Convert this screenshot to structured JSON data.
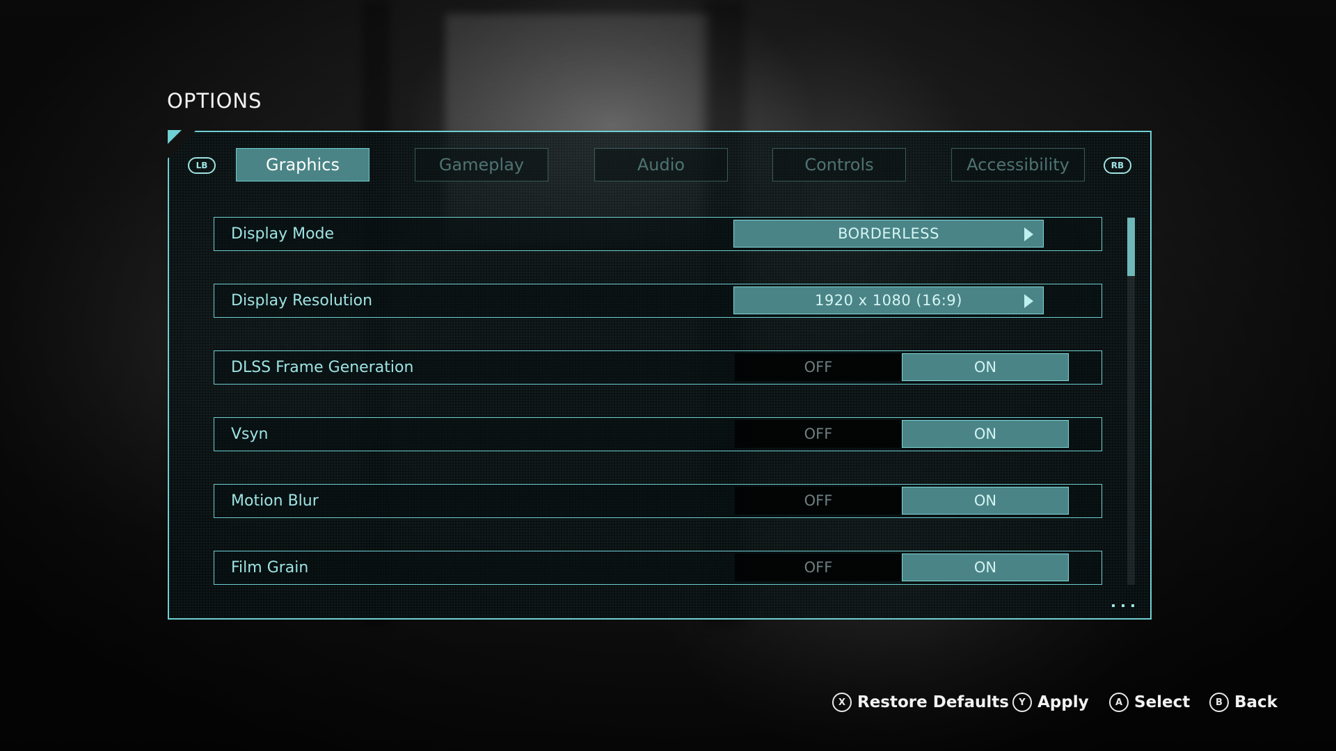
{
  "page": {
    "title": "OPTIONS"
  },
  "tabs": {
    "left_bumper": "LB",
    "right_bumper": "RB",
    "items": [
      {
        "label": "Graphics",
        "active": true
      },
      {
        "label": "Gameplay",
        "active": false
      },
      {
        "label": "Audio",
        "active": false
      },
      {
        "label": "Controls",
        "active": false
      },
      {
        "label": "Accessibility",
        "active": false
      }
    ]
  },
  "settings": [
    {
      "label": "Display Mode",
      "type": "selector",
      "value": "BORDERLESS"
    },
    {
      "label": "Display Resolution",
      "type": "selector",
      "value": "1920 x 1080 (16:9)"
    },
    {
      "label": "DLSS Frame Generation",
      "type": "toggle",
      "off_label": "OFF",
      "on_label": "ON",
      "value": "ON"
    },
    {
      "label": "Vsyn",
      "type": "toggle",
      "off_label": "OFF",
      "on_label": "ON",
      "value": "ON"
    },
    {
      "label": "Motion Blur",
      "type": "toggle",
      "off_label": "OFF",
      "on_label": "ON",
      "value": "ON"
    },
    {
      "label": "Film Grain",
      "type": "toggle",
      "off_label": "OFF",
      "on_label": "ON",
      "value": "ON"
    }
  ],
  "scroll": {
    "position": 0.0,
    "visible_fraction": 0.16
  },
  "footer": {
    "restore": {
      "glyph": "X",
      "label": "Restore Defaults"
    },
    "apply": {
      "glyph": "Y",
      "label": "Apply"
    },
    "select": {
      "glyph": "A",
      "label": "Select"
    },
    "back": {
      "glyph": "B",
      "label": "Back"
    }
  },
  "colors": {
    "accent": "#6fd0d3",
    "active_fill": "#4a8486",
    "text_accent": "#9fe3e3",
    "inactive_tab_text": "#4f7373"
  }
}
